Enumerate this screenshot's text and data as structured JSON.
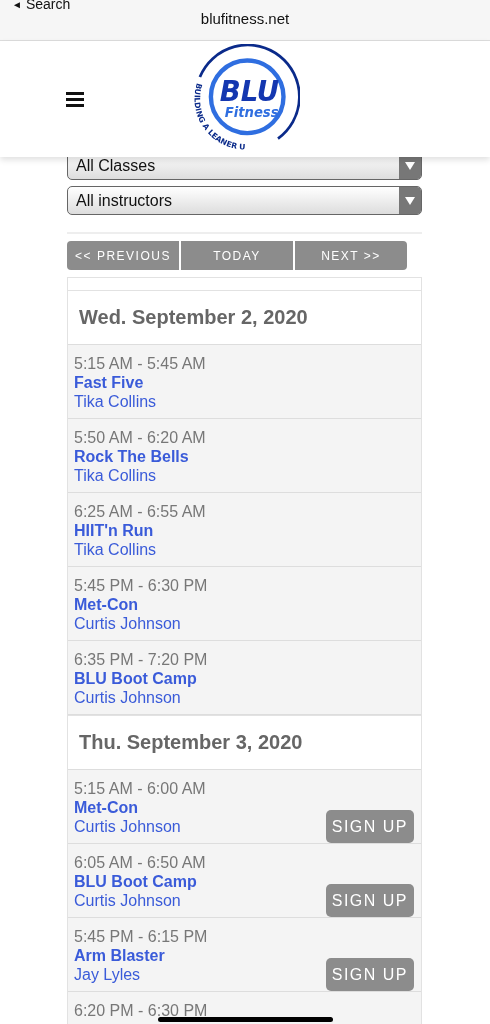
{
  "browser": {
    "back_icon": "◄",
    "back_label": "Search",
    "url": "blufitness.net"
  },
  "logo": {
    "main": "BLU",
    "sub": "Fitness",
    "tagline": "BUILDING A LEANER U"
  },
  "filters": [
    {
      "value": "All Classes",
      "partly_hidden": true
    },
    {
      "value": "All instructors",
      "partly_hidden": false
    }
  ],
  "nav": [
    "<< PREVIOUS",
    "TODAY",
    "NEXT >>"
  ],
  "days": [
    {
      "date": "Wed. September 2, 2020",
      "classes": [
        {
          "time": "5:15 AM - 5:45 AM",
          "name": "Fast Five",
          "instructor": "Tika Collins"
        },
        {
          "time": "5:50 AM - 6:20 AM",
          "name": "Rock The Bells",
          "instructor": "Tika Collins"
        },
        {
          "time": "6:25 AM - 6:55 AM",
          "name": "HIIT'n Run",
          "instructor": "Tika Collins"
        },
        {
          "time": "5:45 PM - 6:30 PM",
          "name": "Met-Con",
          "instructor": "Curtis Johnson"
        },
        {
          "time": "6:35 PM - 7:20 PM",
          "name": "BLU Boot Camp",
          "instructor": "Curtis Johnson"
        }
      ]
    },
    {
      "date": "Thu. September 3, 2020",
      "classes": [
        {
          "time": "5:15 AM - 6:00 AM",
          "name": "Met-Con",
          "instructor": "Curtis Johnson",
          "action": "SIGN UP"
        },
        {
          "time": "6:05 AM - 6:50 AM",
          "name": "BLU Boot Camp",
          "instructor": "Curtis Johnson",
          "action": "SIGN UP"
        },
        {
          "time": "5:45 PM - 6:15 PM",
          "name": "Arm Blaster",
          "instructor": "Jay Lyles",
          "action": "SIGN UP"
        },
        {
          "time": "6:20 PM - 6:30 PM"
        }
      ]
    }
  ]
}
